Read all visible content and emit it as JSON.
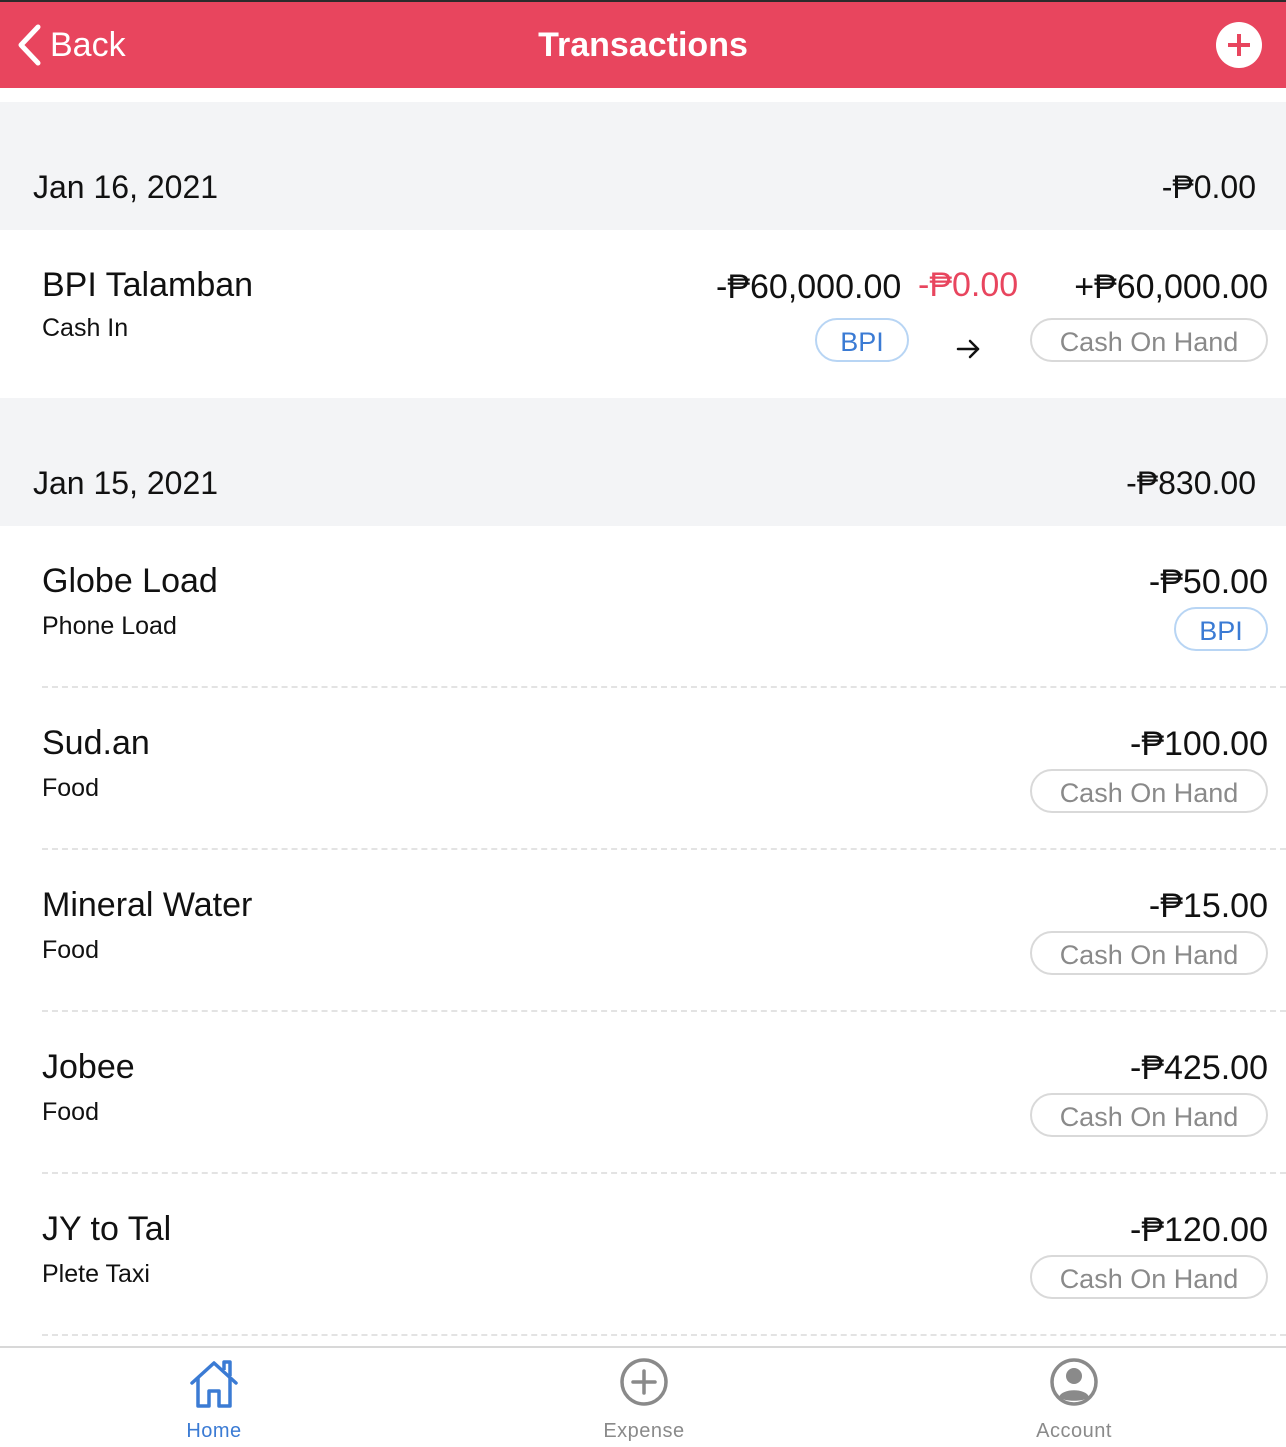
{
  "navbar": {
    "back_label": "Back",
    "title": "Transactions"
  },
  "days": [
    {
      "date": "Jan 16, 2021",
      "total": "-₱0.00",
      "transfer": {
        "title": "BPI Talamban",
        "category": "Cash In",
        "from_amount": "-₱60,000.00",
        "fee": "-₱0.00",
        "to_amount": "+₱60,000.00",
        "from_account": "BPI",
        "to_account": "Cash On Hand"
      }
    },
    {
      "date": "Jan 15, 2021",
      "total": "-₱830.00",
      "items": [
        {
          "title": "Globe Load",
          "category": "Phone Load",
          "amount": "-₱50.00",
          "account": "BPI"
        },
        {
          "title": "Sud.an",
          "category": "Food",
          "amount": "-₱100.00",
          "account": "Cash On Hand"
        },
        {
          "title": "Mineral Water",
          "category": "Food",
          "amount": "-₱15.00",
          "account": "Cash On Hand"
        },
        {
          "title": "Jobee",
          "category": "Food",
          "amount": "-₱425.00",
          "account": "Cash On Hand"
        },
        {
          "title": "JY to Tal",
          "category": "Plete Taxi",
          "amount": "-₱120.00",
          "account": "Cash On Hand"
        }
      ]
    }
  ],
  "tabs": [
    {
      "label": "Home",
      "icon": "home-icon",
      "active": true
    },
    {
      "label": "Expense",
      "icon": "plus-circle-icon",
      "active": false
    },
    {
      "label": "Account",
      "icon": "user-circle-icon",
      "active": false
    }
  ],
  "colors": {
    "primary": "#e8455e",
    "link": "#3b7bd4",
    "muted": "#8a8a8a"
  }
}
